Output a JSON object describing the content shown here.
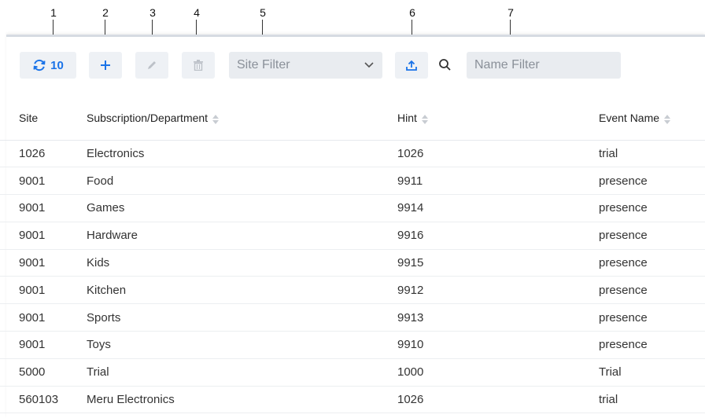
{
  "callouts": [
    "1",
    "2",
    "3",
    "4",
    "5",
    "6",
    "7"
  ],
  "toolbar": {
    "refresh_count": "10",
    "site_filter_placeholder": "Site Filter",
    "name_filter_placeholder": "Name Filter",
    "accent_color": "#1a73e8",
    "icons": [
      "refresh-icon",
      "plus-icon",
      "pencil-icon",
      "trash-icon",
      "chevron-down-icon",
      "upload-icon",
      "search-icon"
    ]
  },
  "table": {
    "columns": [
      "Site",
      "Subscription/Department",
      "Hint",
      "Event Name"
    ],
    "rows": [
      [
        "1026",
        "Electronics",
        "1026",
        "trial"
      ],
      [
        "9001",
        "Food",
        "9911",
        "presence"
      ],
      [
        "9001",
        "Games",
        "9914",
        "presence"
      ],
      [
        "9001",
        "Hardware",
        "9916",
        "presence"
      ],
      [
        "9001",
        "Kids",
        "9915",
        "presence"
      ],
      [
        "9001",
        "Kitchen",
        "9912",
        "presence"
      ],
      [
        "9001",
        "Sports",
        "9913",
        "presence"
      ],
      [
        "9001",
        "Toys",
        "9910",
        "presence"
      ],
      [
        "5000",
        "Trial",
        "1000",
        "Trial"
      ],
      [
        "560103",
        "Meru Electronics",
        "1026",
        "trial"
      ]
    ]
  }
}
